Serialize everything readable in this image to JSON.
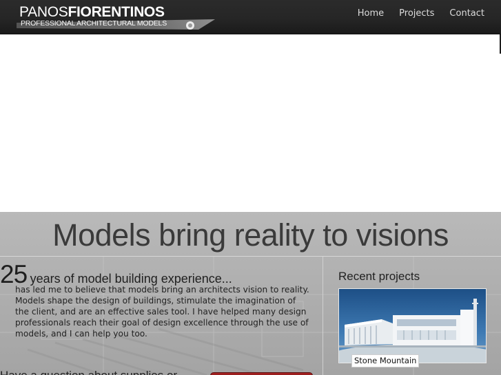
{
  "header": {
    "logo_first": "PANOS",
    "logo_last": "FIORENTINOS",
    "logo_tagline": "PROFESSIONAL ARCHITECTURAL MODELS",
    "nav": [
      "Home",
      "Projects",
      "Contact"
    ]
  },
  "main": {
    "headline": "Models bring reality to visions",
    "years_number": "25",
    "years_label": "years of model building experience...",
    "intro": "has led me to believe that models bring an architects vision to reality. Models shape the design of buildings, stimulate the imagination of the client, and are an effective sales tool. I have helped many design professionals reach their goal of design excellence through the use of models, and I can help you too.",
    "question": "Have a question about supplies or"
  },
  "sidebar": {
    "title": "Recent projects",
    "projects": [
      {
        "caption": "Stone Mountain"
      }
    ]
  },
  "colors": {
    "header_bg": "#262626",
    "main_bg": "#b0b0b0",
    "cta_red": "#8a1a1a"
  }
}
